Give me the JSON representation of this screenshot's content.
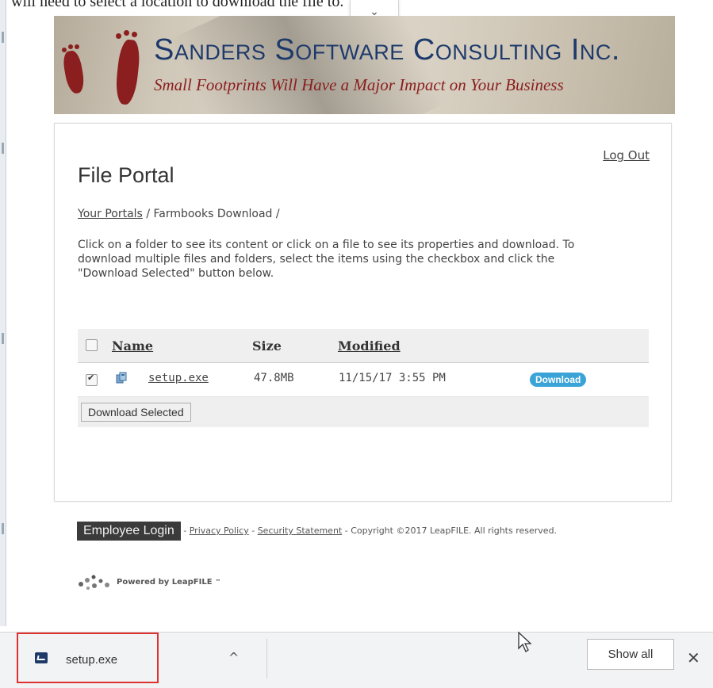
{
  "instruction_text": "will need to select a location to download the file to.",
  "banner": {
    "company": "Sanders Software Consulting Inc.",
    "tagline": "Small Footprints Will Have a Major Impact on Your Business"
  },
  "portal": {
    "logout_label": "Log Out",
    "title": "File Portal",
    "breadcrumb": {
      "link": "Your Portals",
      "sep1": "/",
      "current": "Farmbooks Download",
      "sep2": "/"
    },
    "description": "Click on a folder to see its content or click on a file to see its properties and download. To download multiple files and folders, select the items using the checkbox and click the \"Download Selected\" button below.",
    "table": {
      "headers": {
        "name": "Name",
        "size": "Size",
        "modified": "Modified"
      },
      "rows": [
        {
          "checked": true,
          "name": "setup.exe",
          "size": "47.8MB",
          "modified": "11/15/17 3:55 PM",
          "action": "Download"
        }
      ],
      "download_selected_label": "Download Selected"
    }
  },
  "footer": {
    "employee_login": "Employee Login",
    "sep": "-",
    "privacy": "Privacy Policy",
    "security": "Security Statement",
    "copyright": "- Copyright ©2017 LeapFILE. All rights reserved.",
    "powered_by": "Powered by LeapFILE",
    "tm": "™"
  },
  "download_bar": {
    "file_name": "setup.exe",
    "show_all_label": "Show all",
    "close_glyph": "✕",
    "chevron_glyph": "^"
  }
}
